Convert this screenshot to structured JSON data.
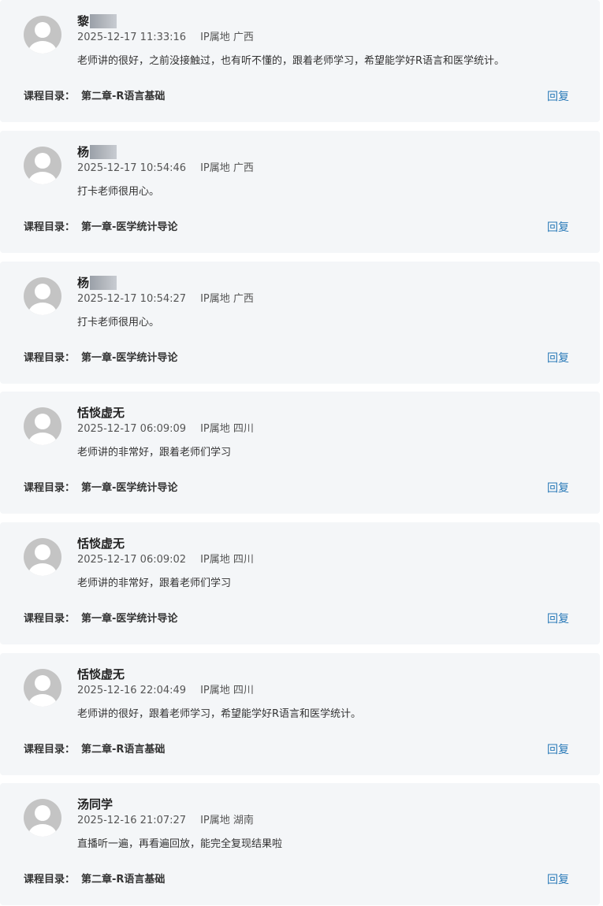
{
  "catalog_label": "课程目录：",
  "reply_label": "回复",
  "ip_prefix": "IP属地",
  "comments": [
    {
      "name": "黎",
      "name_masked": true,
      "time": "2025-12-17 11:33:16",
      "ip": "IP属地 广西",
      "content": "老师讲的很好，之前没接触过，也有听不懂的，跟着老师学习，希望能学好R语言和医学统计。",
      "chapter": "第二章-R语言基础"
    },
    {
      "name": "杨",
      "name_masked": true,
      "time": "2025-12-17 10:54:46",
      "ip": "IP属地 广西",
      "content": "打卡老师很用心。",
      "chapter": "第一章-医学统计导论"
    },
    {
      "name": "杨",
      "name_masked": true,
      "time": "2025-12-17 10:54:27",
      "ip": "IP属地 广西",
      "content": "打卡老师很用心。",
      "chapter": "第一章-医学统计导论"
    },
    {
      "name": "恬惔虚无",
      "name_masked": false,
      "time": "2025-12-17 06:09:09",
      "ip": "IP属地 四川",
      "content": "老师讲的非常好，跟着老师们学习",
      "chapter": "第一章-医学统计导论"
    },
    {
      "name": "恬惔虚无",
      "name_masked": false,
      "time": "2025-12-17 06:09:02",
      "ip": "IP属地 四川",
      "content": "老师讲的非常好，跟着老师们学习",
      "chapter": "第一章-医学统计导论"
    },
    {
      "name": "恬惔虚无",
      "name_masked": false,
      "time": "2025-12-16 22:04:49",
      "ip": "IP属地 四川",
      "content": "老师讲的很好，跟着老师学习，希望能学好R语言和医学统计。",
      "chapter": "第二章-R语言基础"
    },
    {
      "name": "汤同学",
      "name_masked": false,
      "time": "2025-12-16 21:07:27",
      "ip": "IP属地 湖南",
      "content": "直播听一遍，再看遍回放，能完全复现结果啦",
      "chapter": "第二章-R语言基础"
    }
  ]
}
